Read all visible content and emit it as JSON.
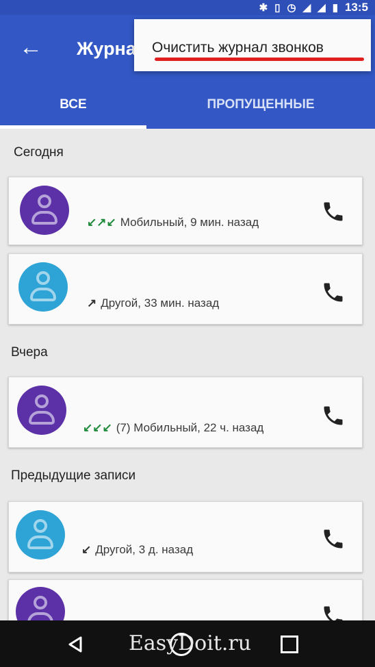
{
  "status_bar": {
    "time": "13:5",
    "icons": [
      "bluetooth-icon",
      "vibrate-icon",
      "alarm-icon",
      "wifi-icon",
      "signal-icon",
      "battery-icon"
    ]
  },
  "app_bar": {
    "back_icon": "arrow-back-icon",
    "title": "Журнал"
  },
  "overflow_menu": {
    "item_label": "Очистить журнал звонков"
  },
  "tabs": [
    {
      "label": "ВСЕ",
      "selected": true
    },
    {
      "label": "ПРОПУЩЕННЫЕ",
      "selected": false
    }
  ],
  "sections": [
    {
      "header": "Сегодня",
      "calls": [
        {
          "avatar_color": "#5c31a8",
          "arrows": "↙↗↙",
          "detail": "Мобильный, 9 мин. назад"
        },
        {
          "avatar_color": "#2ea3d6",
          "arrows": "↗",
          "detail": "Другой, 33 мин. назад"
        }
      ]
    },
    {
      "header": "Вчера",
      "calls": [
        {
          "avatar_color": "#5c31a8",
          "arrows": "↙↙↙",
          "detail": "(7) Мобильный, 22 ч. назад"
        }
      ]
    },
    {
      "header": "Предыдущие записи",
      "calls": [
        {
          "avatar_color": "#2ea3d6",
          "arrows": "↙",
          "detail": "Другой, 3 д. назад"
        },
        {
          "avatar_color": "#5c31a8",
          "arrows": "",
          "detail": ""
        }
      ]
    }
  ],
  "nav_bar": {
    "watermark": "EasyDoit.ru"
  },
  "colors": {
    "primary": "#3358c6",
    "primary_dark": "#2f4fb8",
    "menu_highlight": "#e02020"
  }
}
